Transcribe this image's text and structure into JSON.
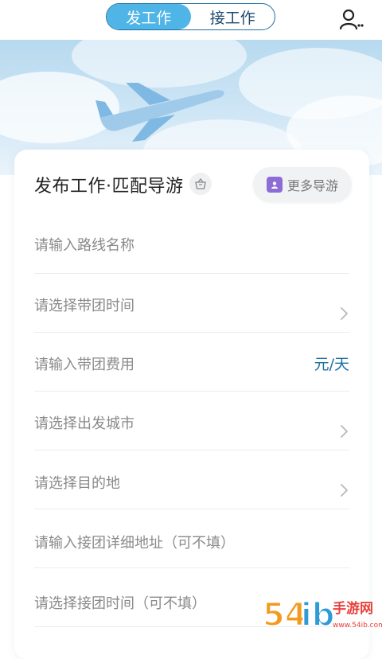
{
  "topbar": {
    "tabs": [
      {
        "label": "发工作",
        "active": true
      },
      {
        "label": "接工作",
        "active": false
      }
    ],
    "user_icon": "user-search-icon"
  },
  "card": {
    "title": "发布工作·匹配导游",
    "title_icon": "basket-icon",
    "more_button": {
      "label": "更多导游",
      "icon": "guide-badge-icon"
    }
  },
  "form": {
    "route_name": {
      "placeholder": "请输入路线名称"
    },
    "lead_time": {
      "placeholder": "请选择带团时间"
    },
    "lead_fee": {
      "placeholder": "请输入带团费用",
      "unit": "元/天"
    },
    "departure_city": {
      "placeholder": "请选择出发城市"
    },
    "destination": {
      "placeholder": "请选择目的地"
    },
    "pickup_address": {
      "placeholder": "请输入接团详细地址（可不填）"
    },
    "pickup_time": {
      "placeholder": "请选择接团时间（可不填）"
    }
  },
  "watermark": {
    "text": "54ib 手游网",
    "sub": "www.54ib.com"
  },
  "colors": {
    "accent": "#4fb4e6",
    "accent_dark": "#1c6fa0",
    "purple": "#8e6cd6"
  }
}
